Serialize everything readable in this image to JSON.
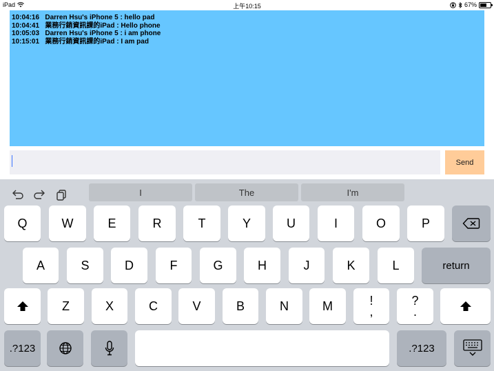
{
  "status_bar": {
    "device": "iPad",
    "time": "上午10:15",
    "battery": "67%",
    "battery_level": 0.67
  },
  "messages": [
    "10:04:16   Darren Hsu's iPhone 5 : hello pad",
    "10:04:41   業務行銷資訊課的iPad : Hello phone",
    "10:05:03   Darren Hsu's iPhone 5 : i am phone",
    "10:15:01   業務行銷資訊課的iPad : I am pad"
  ],
  "input": {
    "value": ""
  },
  "send_label": "Send",
  "suggestions": [
    "I",
    "The",
    "I'm"
  ],
  "keyboard": {
    "row1": [
      "Q",
      "W",
      "E",
      "R",
      "T",
      "Y",
      "U",
      "I",
      "O",
      "P"
    ],
    "row2": [
      "A",
      "S",
      "D",
      "F",
      "G",
      "H",
      "J",
      "K",
      "L"
    ],
    "return_label": "return",
    "row3": [
      "Z",
      "X",
      "C",
      "V",
      "B",
      "N",
      "M"
    ],
    "punct1_top": "!",
    "punct1_bottom": ",",
    "punct2_top": "?",
    "punct2_bottom": ".",
    "numbers_label": ".?123",
    "numbers_label_right": ".?123"
  }
}
